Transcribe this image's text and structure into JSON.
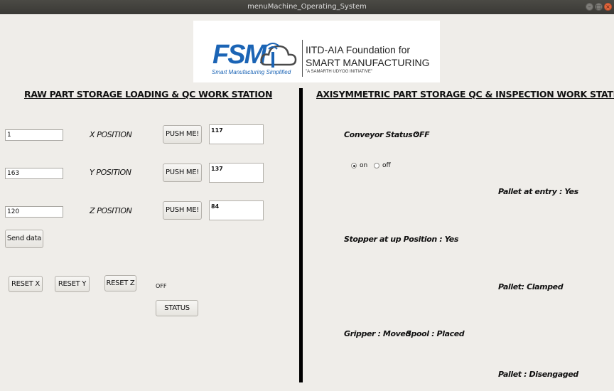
{
  "window": {
    "title": "menuMachine_Operating_System",
    "buttons": [
      "minimize",
      "maximize",
      "close"
    ]
  },
  "logo": {
    "brand": "FSM",
    "tagline": "Smart Manufacturing Simplified",
    "org_line1": "IITD-AIA Foundation for",
    "org_line2": "SMART MANUFACTURING",
    "org_line3": "\"A SAMARTH UDYOG INITIATIVE\""
  },
  "left": {
    "title": "RAW PART STORAGE LOADING & QC WORK STATION",
    "rows": [
      {
        "input": "1",
        "label": "X POSITION",
        "button": "PUSH ME!",
        "output": "117"
      },
      {
        "input": "163",
        "label": "Y POSITION",
        "button": "PUSH ME!",
        "output": "137"
      },
      {
        "input": "120",
        "label": "Z POSITION",
        "button": "PUSH ME!",
        "output": "84"
      }
    ],
    "send_button": "Send data",
    "reset_x": "RESET X",
    "reset_y": "RESET Y",
    "reset_z": "RESET Z",
    "status_text": "OFF",
    "status_button": "STATUS"
  },
  "right": {
    "title": "AXISYMMETRIC PART STORAGE QC & INSPECTION WORK STATION",
    "conveyor_label": "Conveyor Status :",
    "conveyor_value": "OFF",
    "radio_on": "on",
    "radio_off": "off",
    "radio_selected": "on",
    "pallet_entry": "Pallet at entry : Yes",
    "stopper": "Stopper at up Position : Yes",
    "pallet_clamped": "Pallet: Clamped",
    "gripper": "Gripper : Moved",
    "spool": "Spool : Placed",
    "pallet_disengaged": "Pallet : Disengaged"
  },
  "colors": {
    "background": "#efede9",
    "titlebar": "#3f3e3a",
    "brand_blue": "#1b64b5",
    "close_button": "#e2673e",
    "divider": "#000000"
  }
}
